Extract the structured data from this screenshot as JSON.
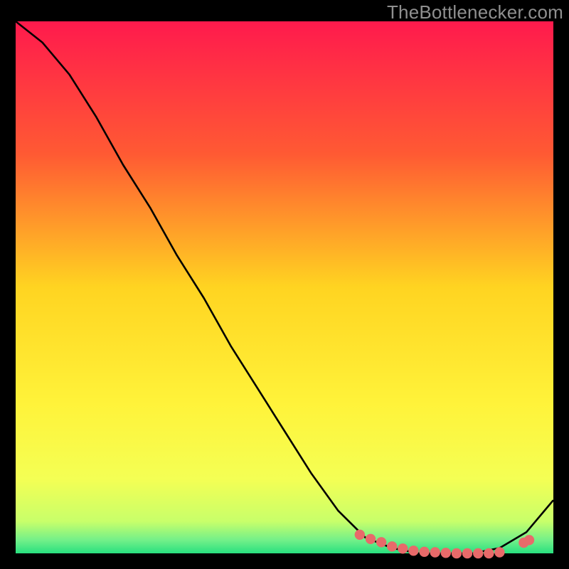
{
  "watermark": "TheBottlenecker.com",
  "chart_data": {
    "type": "line",
    "x": [
      0.0,
      0.05,
      0.1,
      0.15,
      0.2,
      0.25,
      0.3,
      0.35,
      0.4,
      0.45,
      0.5,
      0.55,
      0.6,
      0.65,
      0.7,
      0.75,
      0.8,
      0.85,
      0.9,
      0.95,
      1.0
    ],
    "series": [
      {
        "name": "curve",
        "values": [
          1.0,
          0.96,
          0.9,
          0.82,
          0.73,
          0.65,
          0.56,
          0.48,
          0.39,
          0.31,
          0.23,
          0.15,
          0.08,
          0.03,
          0.01,
          0.0,
          0.0,
          0.0,
          0.01,
          0.04,
          0.1
        ]
      }
    ],
    "markers": {
      "x": [
        0.64,
        0.66,
        0.68,
        0.7,
        0.72,
        0.74,
        0.76,
        0.78,
        0.8,
        0.82,
        0.84,
        0.86,
        0.88,
        0.9,
        0.945,
        0.955
      ],
      "y": [
        0.035,
        0.027,
        0.021,
        0.013,
        0.009,
        0.005,
        0.003,
        0.002,
        0.001,
        0.0,
        0.0,
        0.0,
        0.0,
        0.002,
        0.02,
        0.025
      ]
    },
    "xlim": [
      0,
      1
    ],
    "ylim": [
      0,
      1
    ],
    "background": {
      "type": "vertical-gradient",
      "stops": [
        {
          "offset": 0.0,
          "color": "#ff1a4d"
        },
        {
          "offset": 0.25,
          "color": "#ff5a33"
        },
        {
          "offset": 0.5,
          "color": "#ffd421"
        },
        {
          "offset": 0.72,
          "color": "#fff33a"
        },
        {
          "offset": 0.86,
          "color": "#f4ff54"
        },
        {
          "offset": 0.94,
          "color": "#c8ff6a"
        },
        {
          "offset": 0.975,
          "color": "#73f089"
        },
        {
          "offset": 1.0,
          "color": "#28e07f"
        }
      ]
    },
    "marker_color": "#e86a6a",
    "line_color": "#000000",
    "title": "",
    "xlabel": "",
    "ylabel": ""
  }
}
